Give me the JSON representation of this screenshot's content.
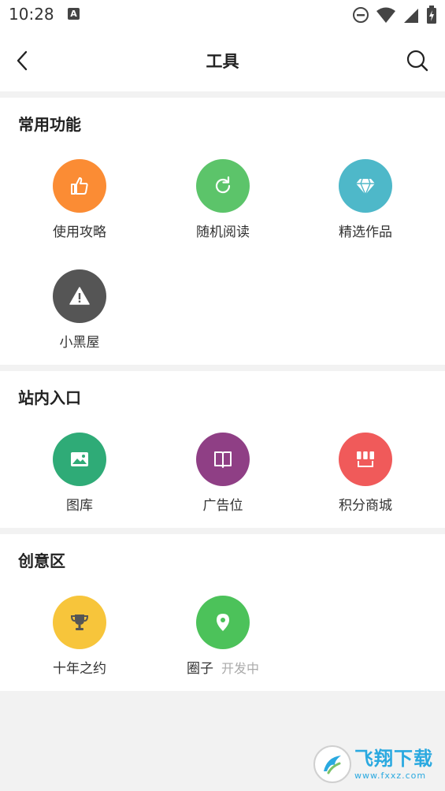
{
  "status_bar": {
    "time": "10:28",
    "notif_letter": "A"
  },
  "app_bar": {
    "title": "工具"
  },
  "sections": [
    {
      "title": "常用功能",
      "items": [
        {
          "label": "使用攻略",
          "icon": "thumbs-up-icon",
          "color": "#fb8c34"
        },
        {
          "label": "随机阅读",
          "icon": "refresh-icon",
          "color": "#5cc46a"
        },
        {
          "label": "精选作品",
          "icon": "diamond-icon",
          "color": "#4eb8c9"
        },
        {
          "label": "小黑屋",
          "icon": "warning-icon",
          "color": "#555555"
        }
      ]
    },
    {
      "title": "站内入口",
      "items": [
        {
          "label": "图库",
          "icon": "image-icon",
          "color": "#2fab77"
        },
        {
          "label": "广告位",
          "icon": "book-icon",
          "color": "#8f3f85"
        },
        {
          "label": "积分商城",
          "icon": "shop-icon",
          "color": "#f05a5a"
        }
      ]
    },
    {
      "title": "创意区",
      "items": [
        {
          "label": "十年之约",
          "icon": "trophy-icon",
          "color": "#f7c53b"
        },
        {
          "label": "圈子",
          "badge": "开发中",
          "icon": "location-pin-icon",
          "color": "#4cc25a"
        }
      ]
    }
  ],
  "watermark": {
    "cn": "飞翔下载",
    "en": "www.fxxz.com"
  }
}
